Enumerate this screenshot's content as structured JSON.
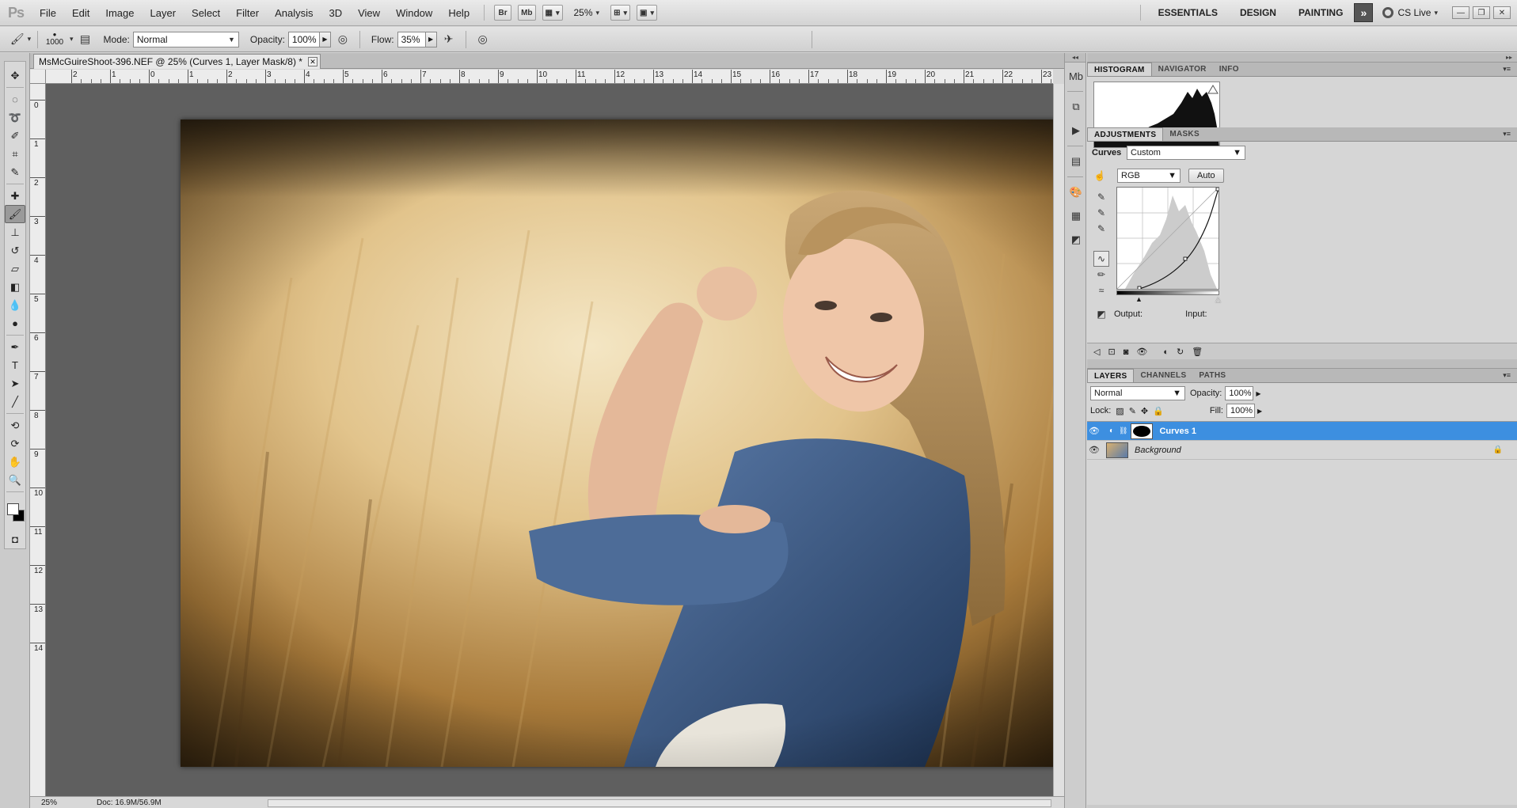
{
  "app": {
    "logo": "Ps",
    "menu": [
      "File",
      "Edit",
      "Image",
      "Layer",
      "Select",
      "Filter",
      "Analysis",
      "3D",
      "View",
      "Window",
      "Help"
    ],
    "bridge_label": "Br",
    "minibridge_label": "Mb",
    "zoom": "25%",
    "workspaces": [
      "ESSENTIALS",
      "DESIGN",
      "PAINTING"
    ],
    "cs_live": "CS Live"
  },
  "options": {
    "brush_size": "1000",
    "mode_label": "Mode:",
    "mode_value": "Normal",
    "opacity_label": "Opacity:",
    "opacity_value": "100%",
    "flow_label": "Flow:",
    "flow_value": "35%"
  },
  "document": {
    "tab_title": "MsMcGuireShoot-396.NEF @ 25% (Curves 1, Layer Mask/8) *",
    "ruler_h_labels": [
      "2",
      "1",
      "0",
      "1",
      "2",
      "3",
      "4",
      "5",
      "6",
      "7",
      "8",
      "9",
      "10",
      "11",
      "12",
      "13",
      "14",
      "15",
      "16",
      "17",
      "18",
      "19",
      "20",
      "21",
      "22",
      "23"
    ],
    "ruler_v_labels": [
      "0",
      "1",
      "2",
      "3",
      "4",
      "5",
      "6",
      "7",
      "8",
      "9",
      "10",
      "11",
      "12",
      "13",
      "14"
    ],
    "status_zoom": "25%",
    "status_doc": "Doc: 16.9M/56.9M"
  },
  "panels": {
    "histogram_tabs": [
      "HISTOGRAM",
      "NAVIGATOR",
      "INFO"
    ],
    "adjustment_tabs": [
      "ADJUSTMENTS",
      "MASKS"
    ],
    "curves_label": "Curves",
    "preset_value": "Custom",
    "channel_value": "RGB",
    "auto_label": "Auto",
    "output_label": "Output:",
    "input_label": "Input:",
    "layers_tabs": [
      "LAYERS",
      "CHANNELS",
      "PATHS"
    ],
    "blend_mode": "Normal",
    "opacity_label": "Opacity:",
    "opacity_value": "100%",
    "lock_label": "Lock:",
    "fill_label": "Fill:",
    "fill_value": "100%",
    "layers": [
      {
        "name": "Curves 1",
        "selected": true
      },
      {
        "name": "Background",
        "selected": false
      }
    ]
  },
  "colors": {
    "selection_blue": "#3d8fe0",
    "canvas_gray": "#5f5f5f"
  }
}
